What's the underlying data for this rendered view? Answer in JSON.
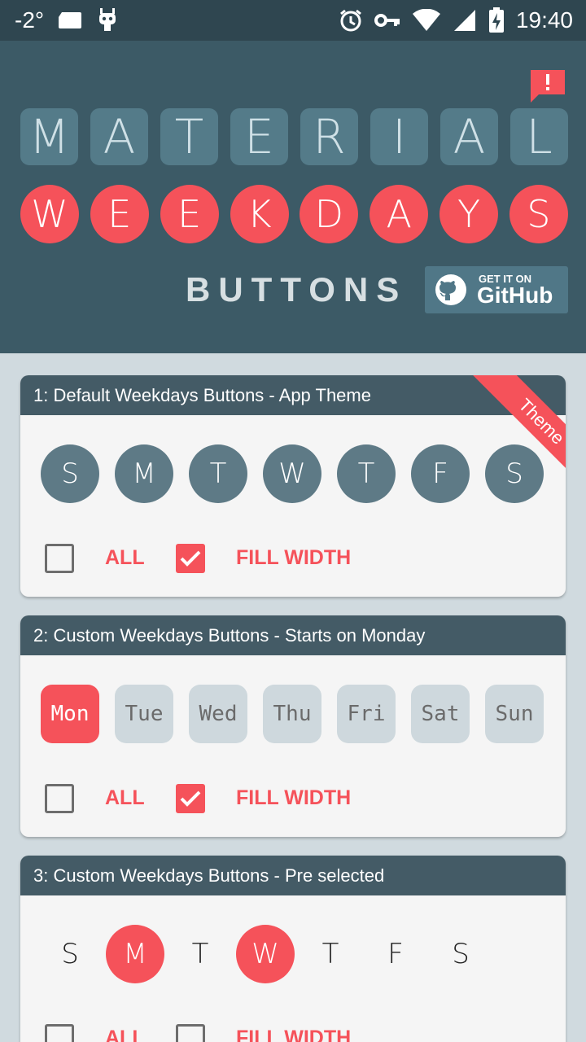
{
  "status_bar": {
    "temperature": "-2°",
    "time": "19:40"
  },
  "hero": {
    "top_letters": [
      "M",
      "A",
      "T",
      "E",
      "R",
      "I",
      "A",
      "L"
    ],
    "circle_letters": [
      "W",
      "E",
      "E",
      "K",
      "D",
      "A",
      "Y",
      "S"
    ],
    "subtitle": "BUTTONS",
    "github_small": "GET IT ON",
    "github_big": "GitHub"
  },
  "cards": [
    {
      "title": "1: Default Weekdays Buttons - App Theme",
      "ribbon": "Theme",
      "days": [
        "S",
        "M",
        "T",
        "W",
        "T",
        "F",
        "S"
      ],
      "all_label": "ALL",
      "fill_label": "FILL WIDTH",
      "all_checked": false,
      "fill_checked": true
    },
    {
      "title": "2: Custom Weekdays Buttons - Starts on Monday",
      "days": [
        "Mon",
        "Tue",
        "Wed",
        "Thu",
        "Fri",
        "Sat",
        "Sun"
      ],
      "selected": [
        "Mon"
      ],
      "all_label": "ALL",
      "fill_label": "FILL WIDTH",
      "all_checked": false,
      "fill_checked": true
    },
    {
      "title": "3: Custom Weekdays Buttons - Pre selected",
      "days": [
        "S",
        "M",
        "T",
        "W",
        "T",
        "F",
        "S"
      ],
      "selected_indices": [
        1,
        3
      ],
      "all_label": "ALL",
      "fill_label": "FILL WIDTH",
      "all_checked": false,
      "fill_checked": false
    }
  ],
  "colors": {
    "accent": "#f5525a",
    "primary": "#3c5a66",
    "primary_dark": "#2f4650",
    "tile": "#547b89",
    "card_head": "#445b66"
  }
}
